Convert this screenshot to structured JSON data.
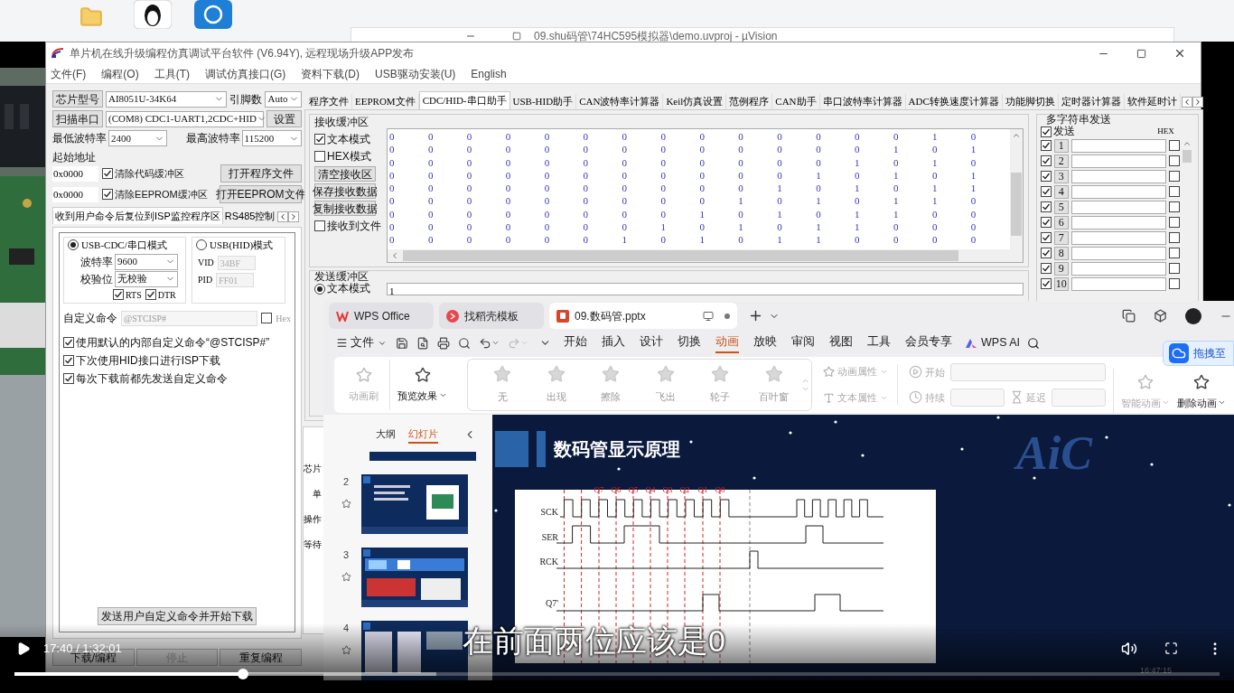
{
  "background_window": {
    "title": "09.shu码管\\74HC595模拟器\\demo.uvproj - µVision"
  },
  "isp": {
    "title": "单片机在线升级编程仿真调试平台软件 (V6.94Y), 远程现场升级APP发布",
    "menu": [
      "文件(F)",
      "编程(O)",
      "工具(T)",
      "调试仿真接口(G)",
      "资料下载(D)",
      "USB驱动安装(U)",
      "English"
    ],
    "chip_button": "芯片型号",
    "chip_value": "AI8051U-34K64",
    "pins_label": "引脚数",
    "pins_value": "Auto",
    "scan_button": "扫描串口",
    "port_value": "(COM8) CDC1-UART1,2CDC+HID",
    "settings_button": "设置",
    "min_baud_label": "最低波特率",
    "min_baud": "2400",
    "max_baud_label": "最高波特率",
    "max_baud": "115200",
    "start_address_label": "起始地址",
    "address_rows": [
      {
        "value": "0x0000",
        "label": "清除代码缓冲区",
        "checked": true,
        "button": "打开程序文件"
      },
      {
        "value": "0x0000",
        "label": "清除EEPROM缓冲区",
        "checked": true,
        "button": "打开EEPROM文件"
      }
    ],
    "option_tabs": [
      {
        "label": "收到用户命令后复位到ISP监控程序区",
        "selected": true
      },
      {
        "label": "RS485控制",
        "selected": false
      }
    ],
    "modes": [
      {
        "label": "USB-CDC/串口模式",
        "selected": true
      },
      {
        "label": "USB(HID)模式",
        "selected": false
      }
    ],
    "baud_label": "波特率",
    "baud": "9600",
    "parity_label": "校验位",
    "parity": "无校验",
    "line_checks": [
      {
        "label": "RTS",
        "checked": true
      },
      {
        "label": "DTR",
        "checked": true
      }
    ],
    "vid_label": "VID",
    "vid": "34BF",
    "pid_label": "PID",
    "pid": "FF01",
    "custom_command_label": "自定义命令",
    "custom_command": "@STCISP#",
    "hex": {
      "label": "Hex",
      "checked": false
    },
    "options": [
      {
        "label": "使用默认的内部自定义命令“@STCISP#”",
        "checked": true
      },
      {
        "label": "下次使用HID接口进行ISP下载",
        "checked": true
      },
      {
        "label": "每次下载前都先发送自定义命令",
        "checked": true
      }
    ],
    "send_command_button": "发送用户自定义命令并开始下载",
    "bottom_buttons": [
      {
        "label": "下载/编程",
        "disabled": false
      },
      {
        "label": "停止",
        "disabled": true
      },
      {
        "label": "重复编程",
        "disabled": false
      }
    ],
    "tabs": [
      {
        "label": "程序文件",
        "selected": false
      },
      {
        "label": "EEPROM文件",
        "selected": false
      },
      {
        "label": "CDC/HID-串口助手",
        "selected": true
      },
      {
        "label": "USB-HID助手",
        "selected": false
      },
      {
        "label": "CAN波特率计算器",
        "selected": false
      },
      {
        "label": "Keil仿真设置",
        "selected": false
      },
      {
        "label": "范例程序",
        "selected": false
      },
      {
        "label": "CAN助手",
        "selected": false
      },
      {
        "label": "串口波特率计算器",
        "selected": false
      },
      {
        "label": "ADC转换速度计算器",
        "selected": false
      },
      {
        "label": "功能脚切换",
        "selected": false
      },
      {
        "label": "定时器计算器",
        "selected": false
      },
      {
        "label": "软件延时计",
        "selected": false
      }
    ],
    "receive": {
      "title": "接收缓冲区",
      "modes": [
        {
          "label": "文本模式",
          "checked": true
        },
        {
          "label": "HEX模式",
          "checked": false
        }
      ],
      "buttons": [
        "清空接收区",
        "保存接收数据",
        "复制接收数据"
      ],
      "file": {
        "label": "接收到文件",
        "checked": false
      },
      "rows": [
        [
          "0",
          "0",
          "0",
          "0",
          "0",
          "0",
          "0",
          "0",
          "0",
          "0",
          "0",
          "0",
          "0",
          "0",
          "1",
          "0"
        ],
        [
          "0",
          "0",
          "0",
          "0",
          "0",
          "0",
          "0",
          "0",
          "0",
          "0",
          "0",
          "0",
          "0",
          "1",
          "0",
          "1"
        ],
        [
          "0",
          "0",
          "0",
          "0",
          "0",
          "0",
          "0",
          "0",
          "0",
          "0",
          "0",
          "0",
          "1",
          "0",
          "1",
          "0"
        ],
        [
          "0",
          "0",
          "0",
          "0",
          "0",
          "0",
          "0",
          "0",
          "0",
          "0",
          "0",
          "1",
          "0",
          "1",
          "0",
          "1"
        ],
        [
          "0",
          "0",
          "0",
          "0",
          "0",
          "0",
          "0",
          "0",
          "0",
          "0",
          "1",
          "0",
          "1",
          "0",
          "1",
          "1"
        ],
        [
          "0",
          "0",
          "0",
          "0",
          "0",
          "0",
          "0",
          "0",
          "0",
          "1",
          "0",
          "1",
          "0",
          "1",
          "1",
          "0"
        ],
        [
          "0",
          "0",
          "0",
          "0",
          "0",
          "0",
          "0",
          "0",
          "1",
          "0",
          "1",
          "0",
          "1",
          "1",
          "0",
          "0"
        ],
        [
          "0",
          "0",
          "0",
          "0",
          "0",
          "0",
          "0",
          "1",
          "0",
          "1",
          "0",
          "1",
          "1",
          "0",
          "0",
          "0"
        ],
        [
          "0",
          "0",
          "0",
          "0",
          "0",
          "0",
          "1",
          "0",
          "1",
          "0",
          "1",
          "1",
          "0",
          "0",
          "0",
          "0"
        ]
      ]
    },
    "send": {
      "title": "发送缓冲区",
      "mode": {
        "label": "文本模式",
        "selected": true
      },
      "value": "1"
    },
    "multi_send": {
      "title": "多字符串发送",
      "send": {
        "label": "发送",
        "checked": true
      },
      "hex_label": "HEX",
      "rows": [
        {
          "number": "1",
          "checked": true,
          "hex": false
        },
        {
          "number": "2",
          "checked": true,
          "hex": false
        },
        {
          "number": "3",
          "checked": true,
          "hex": false
        },
        {
          "number": "4",
          "checked": true,
          "hex": false
        },
        {
          "number": "5",
          "checked": true,
          "hex": false
        },
        {
          "number": "6",
          "checked": true,
          "hex": false
        },
        {
          "number": "7",
          "checked": true,
          "hex": false
        },
        {
          "number": "8",
          "checked": true,
          "hex": false
        },
        {
          "number": "9",
          "checked": true,
          "hex": false
        },
        {
          "number": "10",
          "checked": true,
          "hex": false
        }
      ]
    },
    "hidden_panel": [
      "芯片",
      "单",
      "操作",
      "等待"
    ]
  },
  "wps": {
    "tabs": [
      {
        "label": "WPS Office",
        "selected": false,
        "kind": "home"
      },
      {
        "label": "找稻壳模板",
        "selected": false,
        "kind": "template"
      },
      {
        "label": "09.数码管.pptx",
        "selected": true,
        "kind": "document"
      }
    ],
    "file_menu": "文件",
    "menu": [
      {
        "label": "开始",
        "selected": false
      },
      {
        "label": "插入",
        "selected": false
      },
      {
        "label": "设计",
        "selected": false
      },
      {
        "label": "切换",
        "selected": false
      },
      {
        "label": "动画",
        "selected": true
      },
      {
        "label": "放映",
        "selected": false
      },
      {
        "label": "审阅",
        "selected": false
      },
      {
        "label": "视图",
        "selected": false
      },
      {
        "label": "工具",
        "selected": false
      },
      {
        "label": "会员专享",
        "selected": false
      }
    ],
    "ai": "WPS AI",
    "ribbon_left": [
      {
        "label": "动画刷",
        "disabled": true
      },
      {
        "label": "预览效果",
        "disabled": false
      }
    ],
    "effects": [
      {
        "label": "无",
        "disabled": true
      },
      {
        "label": "出现",
        "disabled": true
      },
      {
        "label": "擦除",
        "disabled": true
      },
      {
        "label": "飞出",
        "disabled": true
      },
      {
        "label": "轮子",
        "disabled": true
      },
      {
        "label": "百叶窗",
        "disabled": true
      }
    ],
    "properties": [
      {
        "label": "动画属性",
        "disabled": true
      },
      {
        "label": "文本属性",
        "disabled": true
      }
    ],
    "timing": [
      {
        "label": "开始",
        "kind": "start"
      },
      {
        "label": "持续",
        "kind": "duration"
      },
      {
        "label": "延迟",
        "kind": "delay"
      }
    ],
    "ribbon_right": [
      {
        "label": "智能动画",
        "disabled": true
      },
      {
        "label": "删除动画",
        "disabled": false
      }
    ],
    "drag_button": "拖拽至",
    "panel_tabs": [
      {
        "label": "大纲",
        "selected": false
      },
      {
        "label": "幻灯片",
        "selected": true
      }
    ],
    "thumbnails": [
      {
        "number": "2"
      },
      {
        "number": "3"
      },
      {
        "number": "4"
      }
    ],
    "slide": {
      "title": "数码管显示原理",
      "logo": "AiC",
      "signals": [
        "SCK",
        "SER",
        "RCK",
        "Q7'"
      ],
      "bit_labels": [
        "Q7",
        "Q6",
        "Q5",
        "Q4",
        "Q3",
        "Q2",
        "Q1",
        "Q0"
      ]
    }
  },
  "player": {
    "subtitle": "在前面两位应该是0",
    "time": "17:40 / 1:32:01",
    "progress": {
      "level": 0.19
    },
    "buffered": {
      "level": 0.35
    },
    "clock": "16:47:15"
  }
}
